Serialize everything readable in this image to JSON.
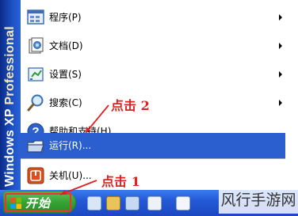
{
  "banner": {
    "windows": "Windows XP",
    "edition": "Professional"
  },
  "menu": {
    "items": [
      {
        "label": "程序(P)",
        "icon": "programs-icon",
        "submenu": true
      },
      {
        "label": "文档(D)",
        "icon": "documents-icon",
        "submenu": true
      },
      {
        "label": "设置(S)",
        "icon": "settings-icon",
        "submenu": true
      },
      {
        "label": "搜索(C)",
        "icon": "search-icon",
        "submenu": true
      },
      {
        "label": "帮助和支持(H)",
        "icon": "help-icon",
        "submenu": false
      },
      {
        "label": "运行(R)...",
        "icon": "run-icon",
        "submenu": false,
        "highlighted": true
      },
      {
        "label": "关机(U)...",
        "icon": "shutdown-icon",
        "submenu": false
      }
    ]
  },
  "taskbar": {
    "start_label": "开始"
  },
  "annotations": {
    "step1": "点击 1",
    "step2": "点击 2"
  },
  "watermark": "风行手游网",
  "colors": {
    "highlight": "#2b5fd0",
    "banner": "#1c4fc2",
    "annotation": "#e02020",
    "start_green": "#36a233"
  }
}
